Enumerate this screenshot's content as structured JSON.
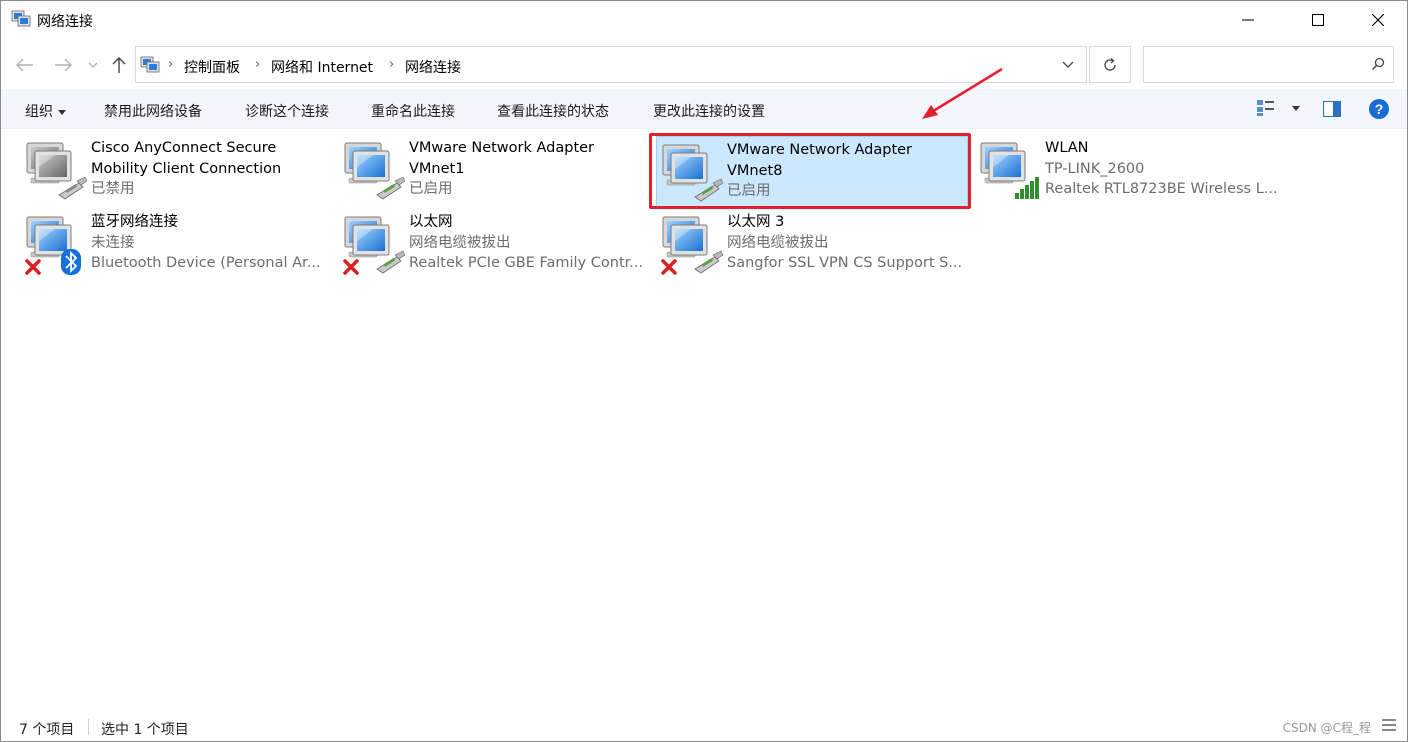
{
  "window": {
    "title": "网络连接",
    "minimize_icon": "minimize-icon",
    "maximize_icon": "maximize-icon",
    "close_icon": "close-icon"
  },
  "address": {
    "breadcrumbs": [
      "控制面板",
      "网络和 Internet",
      "网络连接"
    ],
    "search_placeholder": ""
  },
  "commands": [
    {
      "label": "组织",
      "has_dropdown": true
    },
    {
      "label": "禁用此网络设备"
    },
    {
      "label": "诊断这个连接"
    },
    {
      "label": "重命名此连接"
    },
    {
      "label": "查看此连接的状态"
    },
    {
      "label": "更改此连接的设置"
    }
  ],
  "connections": [
    {
      "name": "Cisco AnyConnect Secure Mobility Client Connection",
      "status": "已禁用",
      "device": "",
      "icon": "ethernet-disabled-icon"
    },
    {
      "name": "VMware Network Adapter VMnet1",
      "status": "已启用",
      "device": "",
      "icon": "ethernet-icon"
    },
    {
      "name": "VMware Network Adapter VMnet8",
      "status": "已启用",
      "device": "",
      "icon": "ethernet-icon",
      "selected": true
    },
    {
      "name": "WLAN",
      "status": "TP-LINK_2600",
      "device": "Realtek RTL8723BE Wireless L...",
      "icon": "wifi-signal-icon"
    },
    {
      "name": "蓝牙网络连接",
      "status": "未连接",
      "device": "Bluetooth Device (Personal Ar...",
      "icon": "bluetooth-icon"
    },
    {
      "name": "以太网",
      "status": "网络电缆被拔出",
      "device": "Realtek PCIe GBE Family Contr...",
      "icon": "ethernet-unplugged-icon"
    },
    {
      "name": "以太网 3",
      "status": "网络电缆被拔出",
      "device": "Sangfor SSL VPN CS Support S...",
      "icon": "ethernet-unplugged-icon"
    }
  ],
  "status_bar": {
    "item_count": "7 个项目",
    "selected_count": "选中 1 个项目",
    "watermark": "CSDN @C程_程"
  },
  "colors": {
    "selected_bg": "#cce8ff",
    "selected_border": "#99d1ff",
    "annotation_red": "#e5202e",
    "cmdbar_bg": "#f3f6fb"
  }
}
